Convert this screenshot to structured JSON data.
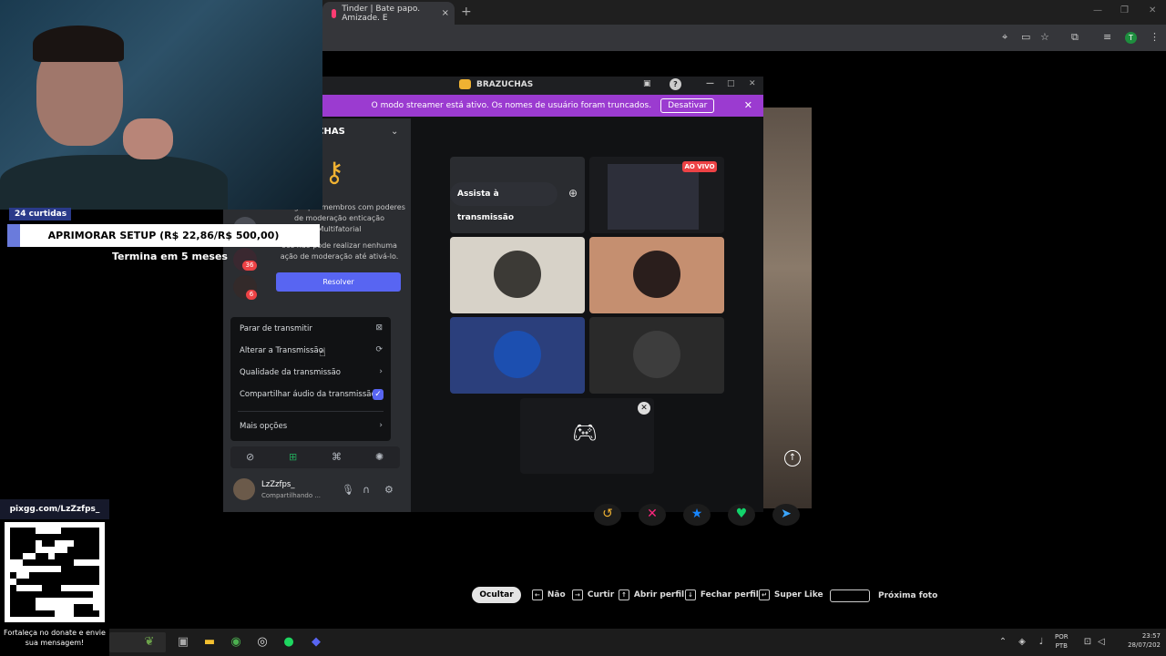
{
  "browser": {
    "tab_title": "Tinder | Bate papo. Amizade. E",
    "tab_close": "×",
    "new_tab": "+",
    "profile_initial": "T"
  },
  "stream_overlay": {
    "likes_label": "24 curtidas",
    "goal_text": "APRIMORAR SETUP (R$ 22,86/R$ 500,00)",
    "ends_text": "Termina em 5 meses",
    "pix_url": "pixgg.com/LzZzfps_",
    "pix_message": "Fortaleça no donate e envie sua mensagem!"
  },
  "discord": {
    "window_title": "BRAZUCHAS",
    "streamer_banner_text": "O modo streamer está ativo. Os nomes de usuário foram truncados.",
    "streamer_disable": "Desativar",
    "server_name": "UCHAS",
    "notice_text_1": "or exige que membros com poderes de moderação enticação Multifatorial",
    "notice_text_2": "ocê não pode realizar nenhuma ação de moderação até ativá-lo.",
    "resolve_button": "Resolver",
    "context_menu": {
      "stop_stream": "Parar de transmitir",
      "change_stream": "Alterar a Transmissão",
      "stream_quality": "Qualidade da transmissão",
      "share_audio": "Compartilhar áudio da transmissão",
      "more_options": "Mais opções"
    },
    "user": {
      "name": "LzZzfps_",
      "status": "Compartilhando ..."
    },
    "watch_stream": "Assista à transmissão",
    "live_badge": "AO VIVO",
    "badges": [
      "36",
      "6"
    ]
  },
  "tinder": {
    "hide_button": "Ocultar",
    "shortcuts": {
      "no": "Não",
      "like": "Curtir",
      "open_profile": "Abrir perfil",
      "close_profile": "Fechar perfil",
      "super_like": "Super Like",
      "next_photo": "Próxima foto"
    }
  },
  "taskbar": {
    "lang_1": "POR",
    "lang_2": "PTB",
    "time": "23:57",
    "date": "28/07/202"
  },
  "colors": {
    "discord_blurple": "#5865f2",
    "streamer_banner": "#9b3bd0",
    "live_red": "#ed4245"
  }
}
